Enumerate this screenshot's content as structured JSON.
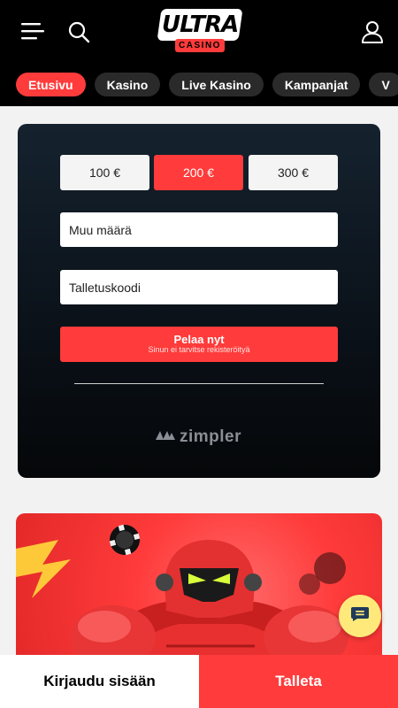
{
  "brand": {
    "logo_main": "ULTRA",
    "logo_sub": "CASINO"
  },
  "nav": {
    "tabs": [
      {
        "label": "Etusivu",
        "active": true
      },
      {
        "label": "Kasino",
        "active": false
      },
      {
        "label": "Live Kasino",
        "active": false
      },
      {
        "label": "Kampanjat",
        "active": false
      },
      {
        "label": "V",
        "active": false
      }
    ]
  },
  "deposit": {
    "amounts": [
      {
        "label": "100 €",
        "selected": false
      },
      {
        "label": "200 €",
        "selected": true
      },
      {
        "label": "300 €",
        "selected": false
      }
    ],
    "other_amount_placeholder": "Muu määrä",
    "deposit_code_placeholder": "Talletuskoodi",
    "play_label": "Pelaa nyt",
    "play_sublabel": "Sinun ei tarvitse rekisteröityä",
    "provider": "zimpler"
  },
  "footer": {
    "login_label": "Kirjaudu sisään",
    "deposit_label": "Talleta"
  },
  "colors": {
    "accent": "#ff3b3b",
    "header_bg": "#000000",
    "chat_bg": "#ffe97a",
    "card_bg": "#0b121a"
  },
  "icons": [
    "hamburger-menu-icon",
    "search-icon",
    "user-icon",
    "chat-icon",
    "zimpler-logo-icon"
  ]
}
